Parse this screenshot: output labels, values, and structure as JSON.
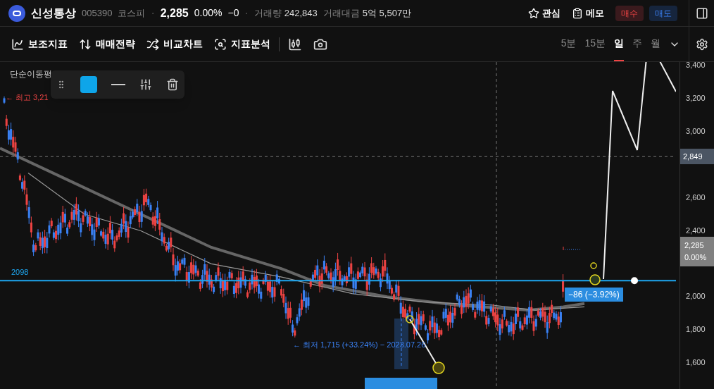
{
  "header": {
    "name": "신성통상",
    "code": "005390",
    "market": "코스피",
    "separators": [
      "·",
      "·"
    ],
    "price": "2,285",
    "change_pct": "0.00%",
    "change": "−0",
    "volume_label": "거래량",
    "volume": "242,843",
    "value_label": "거래대금",
    "value": "5억 5,507만",
    "actions": [
      {
        "kind": "star",
        "label": "관심"
      },
      {
        "kind": "memo",
        "label": "메모"
      }
    ],
    "trade_buttons": [
      {
        "kind": "buy",
        "label": "매수"
      },
      {
        "kind": "sell",
        "label": "매도"
      }
    ]
  },
  "toolbar": {
    "items": [
      {
        "kind": "indicator",
        "label": "보조지표"
      },
      {
        "kind": "strategy",
        "label": "매매전략"
      },
      {
        "kind": "compare",
        "label": "비교차트"
      },
      {
        "kind": "analysis",
        "label": "지표분석"
      }
    ],
    "periods": [
      {
        "label": "5분",
        "selected": false
      },
      {
        "label": "15분",
        "selected": false
      },
      {
        "label": "일",
        "selected": true
      },
      {
        "label": "주",
        "selected": false
      },
      {
        "label": "월",
        "selected": false
      }
    ]
  },
  "chart": {
    "indicator_label": "단순이동평",
    "high_label": "← 최고 3,21",
    "low_label": "← 최저 1,715 (+33.24%) − 2023.07.26",
    "line_label": "2098",
    "delta_badge": "−86 (−3.92%)",
    "y_ticks": [
      "3,400",
      "3,200",
      "3,000",
      "2,600",
      "2,400",
      "2,000",
      "1,800",
      "1,600"
    ],
    "crosshair_tag": "2,849",
    "price_tag": {
      "price": "2,285",
      "change": "0.00%"
    },
    "drawing_toolbar": {
      "color": "#0ea5e9"
    }
  }
}
